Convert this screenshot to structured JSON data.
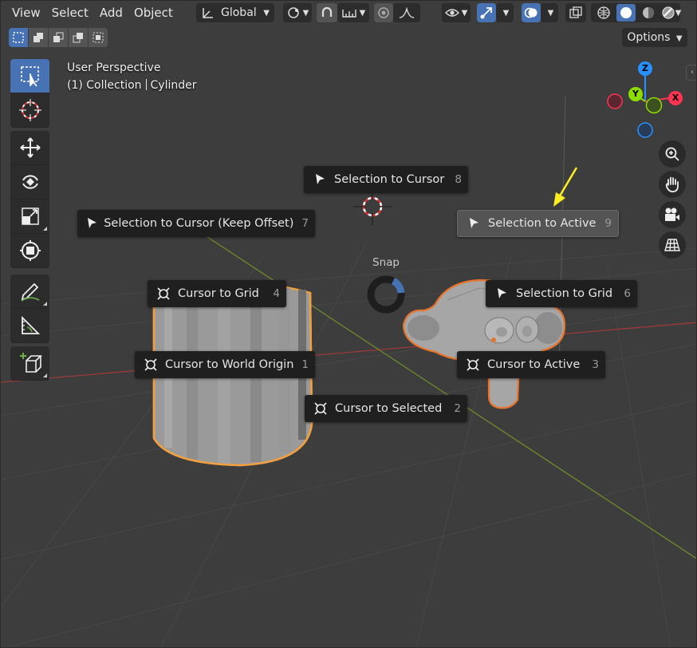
{
  "menu": {
    "view": "View",
    "select": "Select",
    "add": "Add",
    "object": "Object"
  },
  "header": {
    "transform_orientation": "Global"
  },
  "options_label": "Options",
  "viewport_info": {
    "view_name": "User Perspective",
    "collection": "(1) Collection",
    "object_name": "Cylinder"
  },
  "gizmo": {
    "x": "X",
    "y": "Y",
    "z": "Z"
  },
  "pie": {
    "title": "Snap",
    "items": [
      {
        "label": "Selection to Cursor",
        "key": "8",
        "icon": "cursor-arrow-icon"
      },
      {
        "label": "Selection to Cursor (Keep Offset)",
        "key": "7",
        "icon": "cursor-arrow-icon"
      },
      {
        "label": "Selection to Active",
        "key": "9",
        "icon": "cursor-arrow-icon"
      },
      {
        "label": "Cursor to Grid",
        "key": "4",
        "icon": "cursor-target-icon"
      },
      {
        "label": "Selection to Grid",
        "key": "6",
        "icon": "cursor-arrow-icon"
      },
      {
        "label": "Cursor to World Origin",
        "key": "1",
        "icon": "cursor-target-icon"
      },
      {
        "label": "Cursor to Active",
        "key": "3",
        "icon": "cursor-target-icon"
      },
      {
        "label": "Cursor to Selected",
        "key": "2",
        "icon": "cursor-target-icon"
      }
    ]
  },
  "colors": {
    "accent": "#4772b3",
    "selection_outline": "#e8742c",
    "active_outline": "#f0a040",
    "annotation_arrow": "#ffee22",
    "x_axis": "#ff3352",
    "y_axis": "#8bdc00",
    "z_axis": "#2890ff"
  }
}
